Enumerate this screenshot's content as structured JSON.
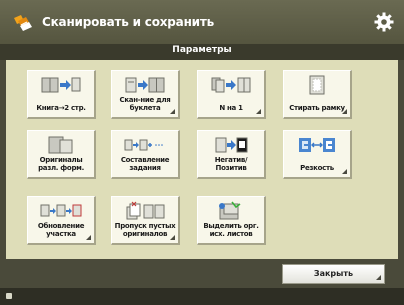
{
  "header": {
    "title": "Сканировать и сохранить"
  },
  "section": {
    "title": "Параметры"
  },
  "tiles": [
    {
      "label": "Книга→2 стр."
    },
    {
      "label": "Скан-ние для буклета"
    },
    {
      "label": "N на 1"
    },
    {
      "label": "Стирать рамку"
    },
    {
      "label": "Оригиналы разл. форм."
    },
    {
      "label": "Составление задания"
    },
    {
      "label": "Негатив/Позитив"
    },
    {
      "label": "Резкость"
    },
    {
      "label": "Обновление участка"
    },
    {
      "label": "Пропуск пустых оригиналов"
    },
    {
      "label": "Выделить орг. исх. листов"
    }
  ],
  "footer": {
    "close_label": "Закрыть"
  },
  "colors": {
    "header_bg": "#5d5d47",
    "panel_bg": "#deddb8",
    "tile_bg": "#f8f7ea",
    "accent_blue": "#3a78c8",
    "icon_orange": "#f2a31b"
  },
  "icons": {
    "app": "scan-save-icon",
    "settings": "gear-icon",
    "tiles": [
      "book-to-two-pages-icon",
      "booklet-scan-icon",
      "n-on-1-icon",
      "erase-frame-icon",
      "different-size-originals-icon",
      "job-build-icon",
      "negative-positive-icon",
      "sharpness-icon",
      "area-update-icon",
      "skip-blank-pages-icon",
      "feed-originals-icon"
    ]
  }
}
